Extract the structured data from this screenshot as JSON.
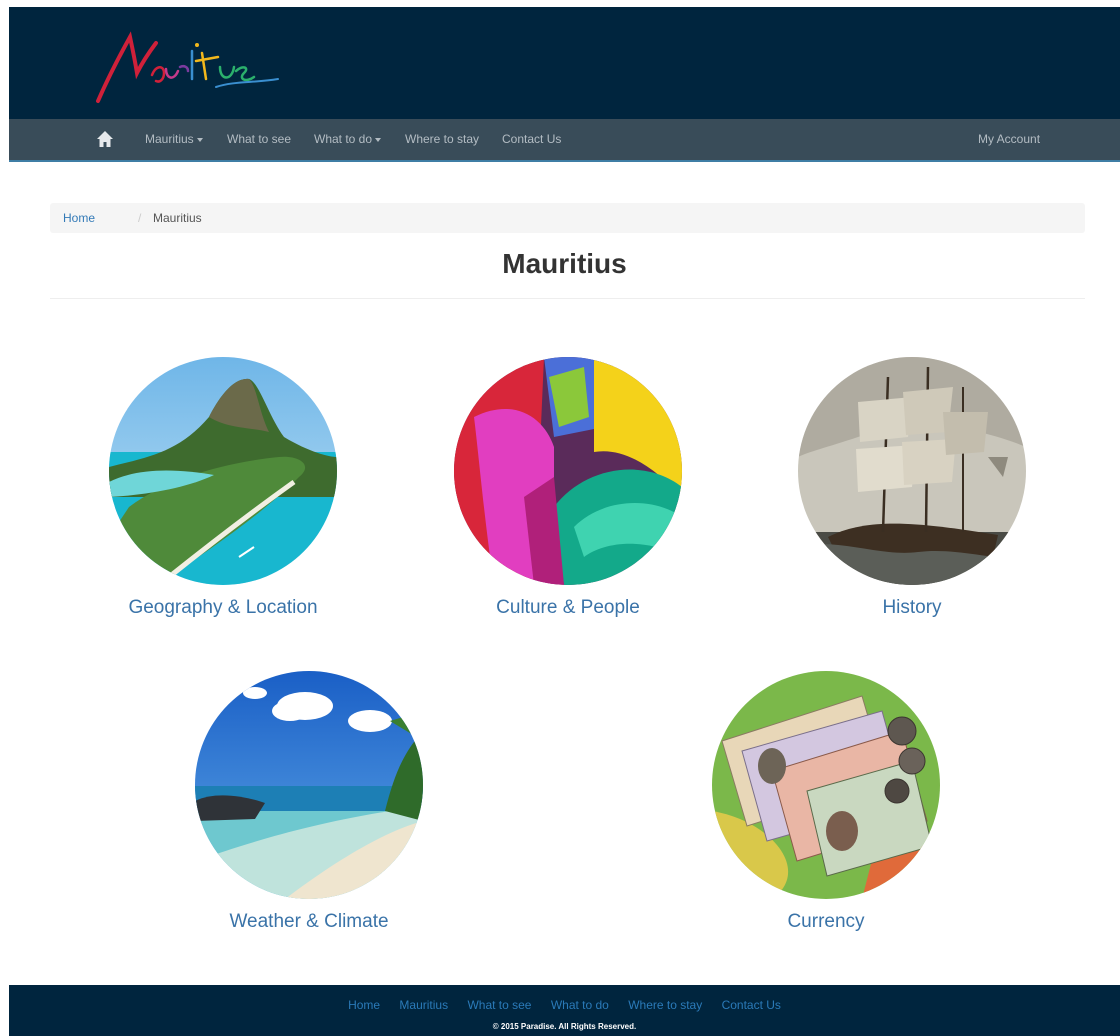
{
  "header": {
    "logo_text": "Mauritius"
  },
  "nav": {
    "home_icon": "home-icon",
    "items": [
      {
        "label": "Mauritius"
      },
      {
        "label": "What to see"
      },
      {
        "label": "What to do"
      },
      {
        "label": "Where to stay"
      },
      {
        "label": "Contact Us"
      }
    ],
    "account": "My Account"
  },
  "breadcrumb": {
    "home": "Home",
    "separator": "/",
    "current": "Mauritius"
  },
  "page_title": "Mauritius",
  "cards": [
    {
      "label": "Geography & Location",
      "image": "island-aerial-photo"
    },
    {
      "label": "Culture & People",
      "image": "colored-powder-photo"
    },
    {
      "label": "History",
      "image": "sailing-ship-painting"
    },
    {
      "label": "Weather & Climate",
      "image": "beach-photo"
    },
    {
      "label": "Currency",
      "image": "banknotes-photo"
    }
  ],
  "footer": {
    "links": [
      "Home",
      "Mauritius",
      "What to see",
      "What to do",
      "Where to stay",
      "Contact Us"
    ],
    "copyright": "© 2015 Paradise. All Rights Reserved."
  },
  "colors": {
    "header_bg": "#00253e",
    "navbar_bg": "#394c59",
    "link": "#337ab7",
    "card_label": "#3a73a8"
  }
}
